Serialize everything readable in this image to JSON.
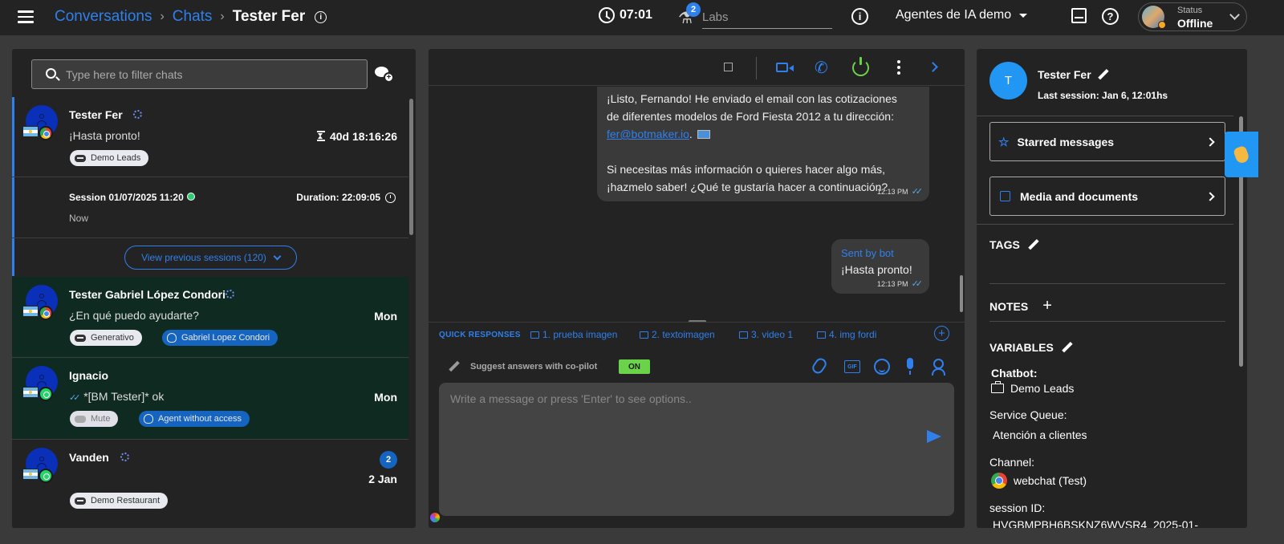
{
  "topbar": {
    "breadcrumb": [
      "Conversations",
      "Chats"
    ],
    "current": "Tester Fer",
    "timer": "07:01",
    "labs_badge": "2",
    "labs_placeholder": "Labs",
    "agent_select": "Agentes de IA demo",
    "status_label": "Status",
    "status_value": "Offline"
  },
  "left": {
    "filter_placeholder": "Type here to filter chats",
    "chats": [
      {
        "name": "Tester Fer",
        "preview": "¡Hasta pronto!",
        "time": "40d 18:16:26",
        "tag": "Demo Leads"
      },
      {
        "name": "Tester Gabriel López Condori",
        "preview": "¿En qué puedo ayudarte?",
        "time": "Mon",
        "tag": "Generativo",
        "agent_tag": "Gabriel Lopez Condori"
      },
      {
        "name": "Ignacio",
        "preview": "*[BM Tester]* ok",
        "time": "Mon",
        "tag": "Mute",
        "agent_tag": "Agent without access"
      },
      {
        "name": "Vanden",
        "preview": "",
        "time": "2 Jan",
        "badge": "2",
        "tag": "Demo Restaurant"
      }
    ],
    "session": {
      "label": "Session 01/07/2025 11:20",
      "now": "Now",
      "duration": "Duration: 22:09:05"
    },
    "prev_sessions": "View previous sessions (120)"
  },
  "middle": {
    "msg1_l1": "¡Listo, Fernando! He enviado el email con las cotizaciones",
    "msg1_l2": "de diferentes modelos de Ford Fiesta 2012 a tu dirección:",
    "msg1_link": "fer@botmaker.io",
    "msg1_l3": "Si necesitas más información o quieres hacer algo más,",
    "msg1_l4": "¡hazmelo saber! ¿Qué te gustaría hacer a continuación?",
    "msg1_time": "12:13 PM",
    "msg2_sender": "Sent by bot",
    "msg2_text": "¡Hasta pronto!",
    "msg2_time": "12:13 PM",
    "quick_title": "QUICK RESPONSES",
    "quick": [
      "1. prueba imagen",
      "2. textoimagen",
      "3. video 1",
      "4. img fordi"
    ],
    "copilot_label": "Suggest answers with co-pilot",
    "copilot_toggle": "ON",
    "gif_label": "GIF",
    "compose_placeholder": "Write a message or press 'Enter' to see options.."
  },
  "right": {
    "avatar_letter": "T",
    "name": "Tester Fer",
    "last_session": "Last session: Jan 6, 12:01hs",
    "starred": "Starred messages",
    "media": "Media and documents",
    "tags": "TAGS",
    "notes": "NOTES",
    "variables": "VARIABLES",
    "chatbot_label": "Chatbot:",
    "chatbot_value": "Demo Leads",
    "queue_label": "Service Queue:",
    "queue_value": "Atención a clientes",
    "channel_label": "Channel:",
    "channel_value": "webchat (Test)",
    "session_label": "session ID:",
    "session_value": "HVGBMPBH6BSKNZ6WVSR4_2025-01-"
  },
  "colors": {
    "accent": "#2f80ed",
    "panel": "#232323",
    "active_green": "#0f2a21",
    "power": "#6bd34a"
  }
}
